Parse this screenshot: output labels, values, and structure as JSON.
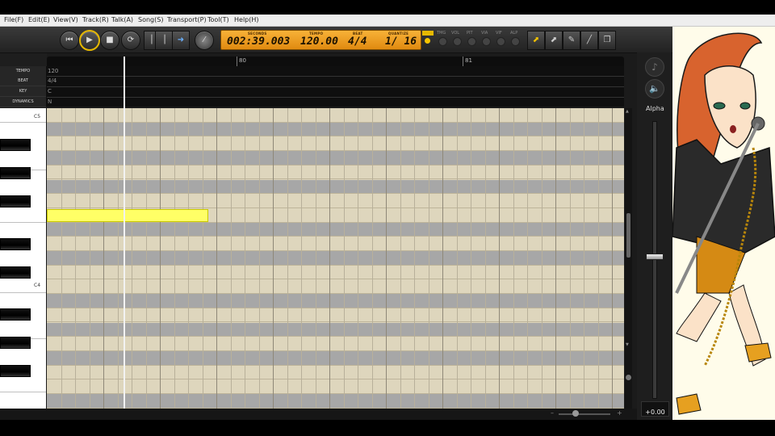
{
  "menu": [
    "File(F)",
    "Edit(E)",
    "View(V)",
    "Track(R)",
    "Talk(A)",
    "Song(S)",
    "Transport(P)",
    "Tool(T)",
    "Help(H)"
  ],
  "transport": {
    "labels": [
      "SECONDS",
      "TEMPO",
      "BEAT",
      "QUANTIZE"
    ],
    "seconds": "002:39.003",
    "tempo": "120.00",
    "beat": "4/4",
    "quantize": "1/ 16"
  },
  "params": [
    "TMG",
    "VOL",
    "PIT",
    "VIA",
    "VIF",
    "ALP"
  ],
  "tracks": {
    "tempo_label": "TEMPO",
    "tempo_value": "120",
    "beat_label": "BEAT",
    "beat_value": "4/4",
    "key_label": "KEY",
    "key_value": "C",
    "dynamics_label": "DYNAMICS",
    "dynamics_value": "N"
  },
  "ruler": {
    "m80": "80",
    "m81": "81"
  },
  "keys": {
    "c5": "C5",
    "c4": "C4"
  },
  "right": {
    "alpha_label": "Alpha",
    "alpha_value": "+0.00"
  },
  "colors": {
    "lcd": "#f3a024",
    "note": "#ffff66",
    "grid_light": "#ded6bd",
    "grid_dark": "#a7a7a7",
    "accent": "#e6b800"
  }
}
